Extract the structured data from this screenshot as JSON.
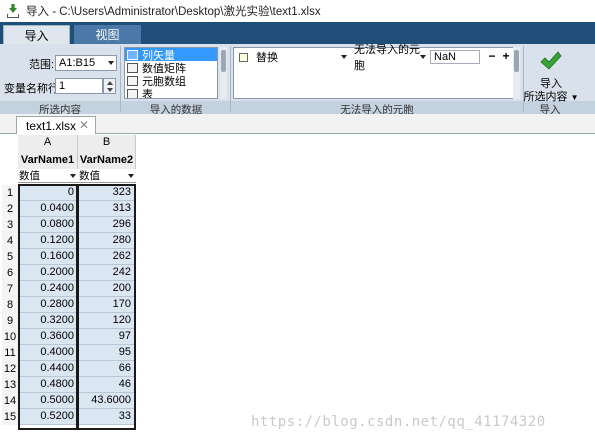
{
  "window": {
    "title": "导入 - C:\\Users\\Administrator\\Desktop\\激光实验\\text1.xlsx"
  },
  "ribbon_tabs": [
    {
      "label": "导入"
    },
    {
      "label": "视图"
    }
  ],
  "selection": {
    "range_label": "范围:",
    "range_value": "A1:B15",
    "varname_label": "变量名称行:",
    "varname_value": "1",
    "group_label": "所选内容"
  },
  "imported_data": {
    "options": [
      "列矢量",
      "数值矩阵",
      "元胞数组",
      "表"
    ],
    "selected_index": 0,
    "group_label": "导入的数据"
  },
  "unimportable": {
    "action": "替换",
    "condition": "无法导入的元胞",
    "replacement": "NaN",
    "minus": "−",
    "plus": "+",
    "group_label": "无法导入的元胞"
  },
  "import_group": {
    "button_line1": "导入",
    "button_line2": "所选内容",
    "group_label": "导入"
  },
  "document": {
    "tab_label": "text1.xlsx",
    "close": "✕"
  },
  "grid": {
    "column_letters": [
      "A",
      "B"
    ],
    "variable_names": [
      "VarName1",
      "VarName2"
    ],
    "column_types": [
      "数值",
      "数值"
    ],
    "row_numbers": [
      "1",
      "2",
      "3",
      "4",
      "5",
      "6",
      "7",
      "8",
      "9",
      "10",
      "11",
      "12",
      "13",
      "14",
      "15"
    ],
    "col_a": [
      "0",
      "0.0400",
      "0.0800",
      "0.1200",
      "0.1600",
      "0.2000",
      "0.2400",
      "0.2800",
      "0.3200",
      "0.3600",
      "0.4000",
      "0.4400",
      "0.4800",
      "0.5000",
      "0.5200"
    ],
    "col_b": [
      "323",
      "313",
      "296",
      "280",
      "262",
      "242",
      "200",
      "170",
      "120",
      "97",
      "95",
      "66",
      "46",
      "43.6000",
      "33"
    ]
  },
  "watermark": "https://blog.csdn.net/qq_41174320",
  "colors": {
    "tab_strip": "#1f4e79",
    "ribbon": "#d9e2ec",
    "cell_fill": "#dbe6f3",
    "selected_option": "#3399ff",
    "check_green": "#3aa335"
  }
}
